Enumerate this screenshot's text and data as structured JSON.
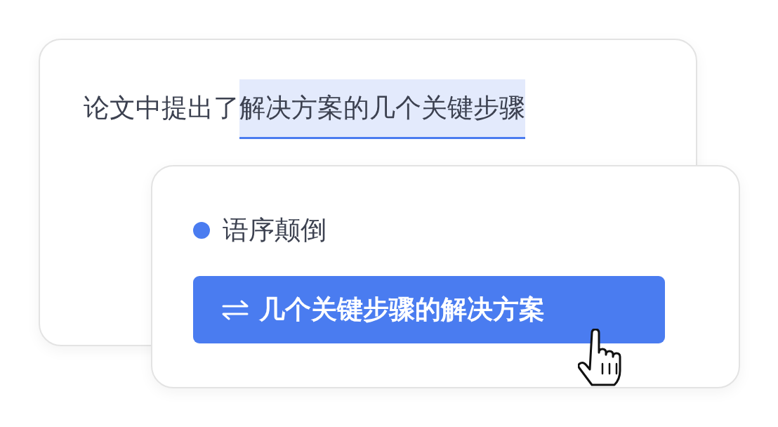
{
  "sentence": {
    "plain": "论文中提出了",
    "highlighted": "解决方案的几个关键步骤"
  },
  "suggestion": {
    "category": "语序颠倒",
    "color": "#4a7cf0",
    "replacement": "几个关键步骤的解决方案"
  }
}
